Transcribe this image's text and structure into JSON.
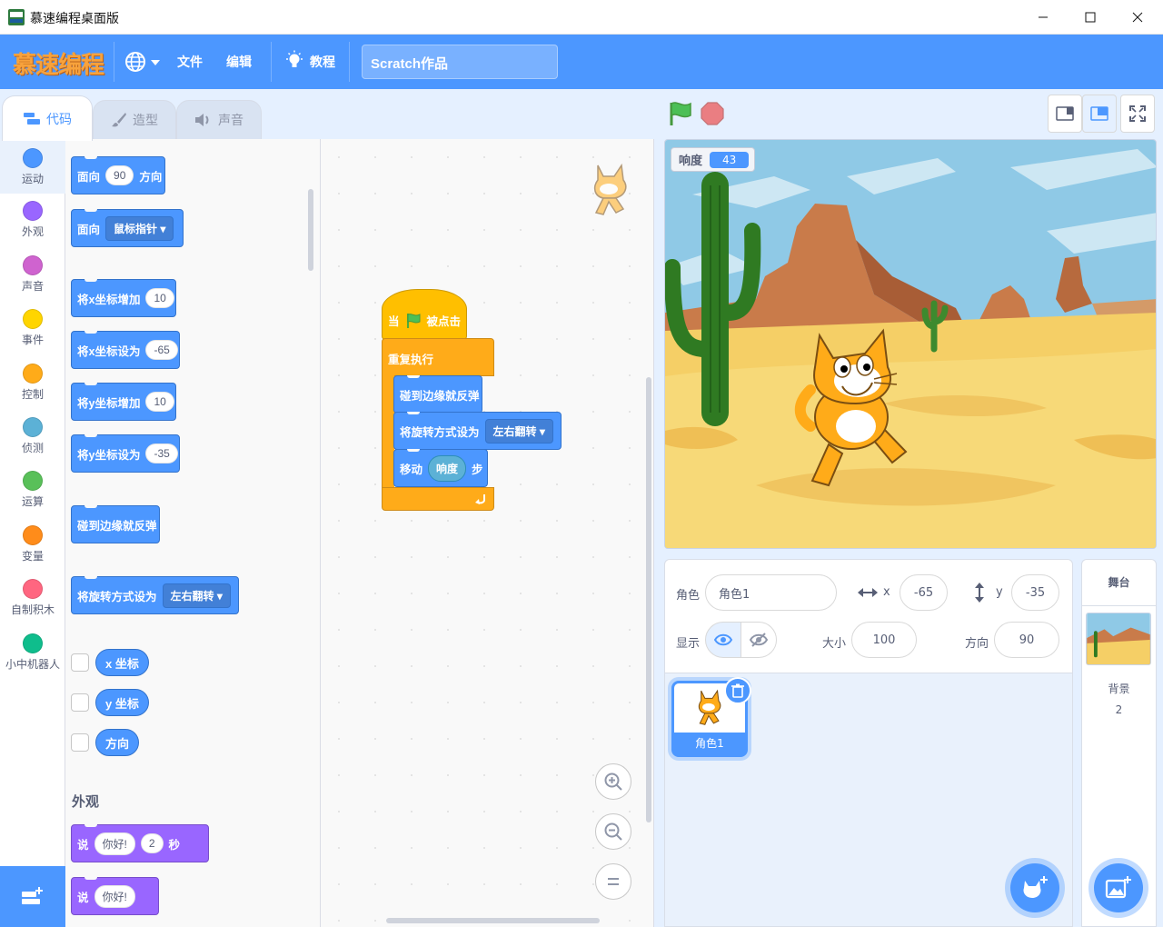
{
  "window": {
    "title": "慕速编程桌面版"
  },
  "menubar": {
    "logo": "慕速编程",
    "file": "文件",
    "edit": "编辑",
    "tutorials": "教程",
    "project_title": "Scratch作品"
  },
  "tabs": {
    "code": "代码",
    "costumes": "造型",
    "sounds": "声音"
  },
  "categories": [
    {
      "label": "运动",
      "color": "#4c97ff"
    },
    {
      "label": "外观",
      "color": "#9966ff"
    },
    {
      "label": "声音",
      "color": "#cf63cf"
    },
    {
      "label": "事件",
      "color": "#ffd500"
    },
    {
      "label": "控制",
      "color": "#ffab19"
    },
    {
      "label": "侦测",
      "color": "#5cb1d6"
    },
    {
      "label": "运算",
      "color": "#59c059"
    },
    {
      "label": "变量",
      "color": "#ff8c1a"
    },
    {
      "label": "自制积木",
      "color": "#ff6680"
    },
    {
      "label": "小中机器人",
      "color": "#0fbd8c"
    }
  ],
  "palette": {
    "point_in_direction": {
      "label_a": "面向",
      "value": "90",
      "label_b": "方向"
    },
    "point_towards": {
      "label": "面向",
      "menu": "鼠标指针"
    },
    "change_x": {
      "label": "将x坐标增加",
      "value": "10"
    },
    "set_x": {
      "label": "将x坐标设为",
      "value": "-65"
    },
    "change_y": {
      "label": "将y坐标增加",
      "value": "10"
    },
    "set_y": {
      "label": "将y坐标设为",
      "value": "-35"
    },
    "bounce": {
      "label": "碰到边缘就反弹"
    },
    "rotation_style": {
      "label": "将旋转方式设为",
      "menu": "左右翻转"
    },
    "reporter_x": "x 坐标",
    "reporter_y": "y 坐标",
    "reporter_direction": "方向",
    "looks_heading": "外观",
    "say_for": {
      "label": "说",
      "message": "你好!",
      "secs": "2",
      "unit": "秒"
    },
    "say": {
      "label": "说",
      "message": "你好!"
    }
  },
  "script": {
    "hat": {
      "label_a": "当",
      "label_b": "被点击"
    },
    "forever": "重复执行",
    "bounce": "碰到边缘就反弹",
    "rotation": {
      "label": "将旋转方式设为",
      "menu": "左右翻转"
    },
    "move": {
      "label_a": "移动",
      "reporter": "响度",
      "label_b": "步"
    }
  },
  "stage": {
    "monitor": {
      "label": "响度",
      "value": "43"
    }
  },
  "sprite_info": {
    "sprite_label": "角色",
    "sprite_name": "角色1",
    "x_label": "x",
    "x_value": "-65",
    "y_label": "y",
    "y_value": "-35",
    "show_label": "显示",
    "size_label": "大小",
    "size_value": "100",
    "direction_label": "方向",
    "direction_value": "90"
  },
  "sprite_list": [
    {
      "name": "角色1"
    }
  ],
  "stage_panel": {
    "title": "舞台",
    "backdrops_label": "背景",
    "backdrops_count": "2"
  },
  "colors": {
    "accent": "#4c97ff",
    "menubar": "#4c97ff",
    "motion": "#4c97ff",
    "events": "#ffbf00",
    "control": "#ffab19",
    "looks": "#9966ff"
  }
}
